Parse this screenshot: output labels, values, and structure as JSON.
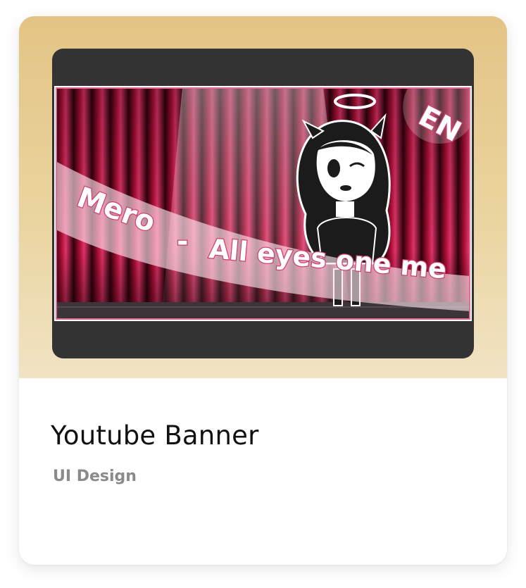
{
  "card": {
    "title": "Youtube Banner",
    "category": "UI Design"
  },
  "thumbnail": {
    "banner_artist": "Mero",
    "banner_separator": "-",
    "banner_song": "All eyes one me",
    "language_badge": "EN"
  },
  "colors": {
    "card_gradient_top": "#e3c485",
    "card_gradient_bottom": "#f1e3c4",
    "device_frame": "#333333",
    "curtain_red": "#c4173f",
    "title_text": "#111111",
    "category_text": "#8a8a8a"
  }
}
